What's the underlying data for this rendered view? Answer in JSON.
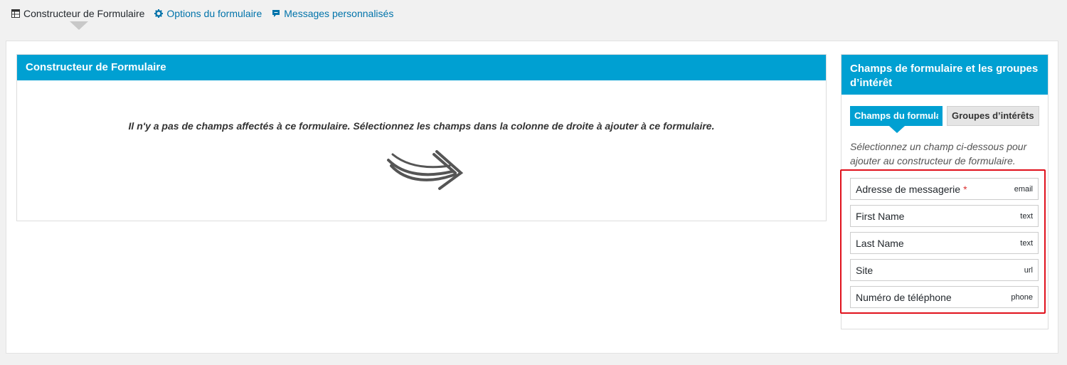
{
  "tabs": [
    {
      "label": "Constructeur de Formulaire",
      "icon": "table-icon",
      "active": true
    },
    {
      "label": "Options du formulaire",
      "icon": "gear-icon",
      "active": false
    },
    {
      "label": "Messages personnalisés",
      "icon": "comment-icon",
      "active": false
    }
  ],
  "builder": {
    "title": "Constructeur de Formulaire",
    "empty_message": "Il n'y a pas de champs affectés à ce formulaire. Sélectionnez les champs dans la colonne de droite à ajouter à ce formulaire.",
    "arrow_icon": "right-arrow-icon"
  },
  "sidebar": {
    "title": "Champs de formulaire et les groupes d’intérêt",
    "tabs": [
      {
        "label": "Champs du formulaire",
        "active": true
      },
      {
        "label": "Groupes d’intérêts",
        "active": false
      }
    ],
    "instructions": "Sélectionnez un champ ci-dessous pour ajouter au constructeur de formulaire.",
    "fields": [
      {
        "label": "Adresse de messagerie",
        "required_mark": "*",
        "type": "email"
      },
      {
        "label": "First Name",
        "required_mark": "",
        "type": "text"
      },
      {
        "label": "Last Name",
        "required_mark": "",
        "type": "text"
      },
      {
        "label": "Site",
        "required_mark": "",
        "type": "url"
      },
      {
        "label": "Numéro de téléphone",
        "required_mark": "",
        "type": "phone"
      }
    ]
  },
  "colors": {
    "accent": "#00a0d2",
    "link": "#0073aa",
    "highlight_border": "#e0111c",
    "required": "#dc3232"
  }
}
